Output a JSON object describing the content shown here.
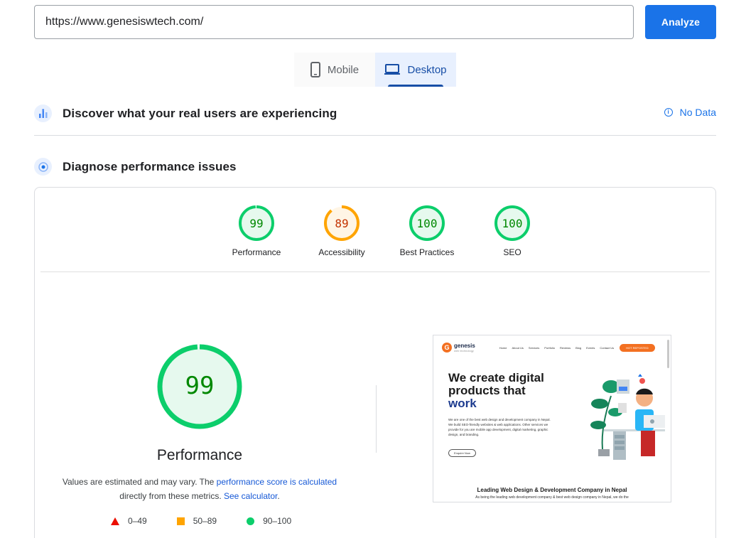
{
  "search": {
    "url": "https://www.genesiswtech.com/",
    "analyze_label": "Analyze"
  },
  "device_tabs": [
    {
      "label": "Mobile",
      "icon": "phone-icon",
      "active": false
    },
    {
      "label": "Desktop",
      "icon": "laptop-icon",
      "active": true
    }
  ],
  "field_section": {
    "title": "Discover what your real users are experiencing",
    "icon": "users-chart-icon",
    "status_icon": "info-icon",
    "status": "No Data"
  },
  "lab_section": {
    "title": "Diagnose performance issues",
    "icon": "target-icon"
  },
  "scores": [
    {
      "label": "Performance",
      "value": 99,
      "rating": "pass"
    },
    {
      "label": "Accessibility",
      "value": 89,
      "rating": "average"
    },
    {
      "label": "Best Practices",
      "value": 100,
      "rating": "pass"
    },
    {
      "label": "SEO",
      "value": 100,
      "rating": "pass"
    }
  ],
  "colors": {
    "pass": "#0cce6b",
    "pass_text": "#008800",
    "pass_fill": "#e6f9ee",
    "average": "#ffa400",
    "average_text": "#c33300",
    "average_fill": "#fff5e5",
    "fail": "#eb0f00",
    "accent": "#1a73e8"
  },
  "detail": {
    "value": 99,
    "label": "Performance",
    "note_prefix": "Values are estimated and may vary. The ",
    "note_link1": "performance score is calculated",
    "note_middle": " directly from these metrics. ",
    "note_link2": "See calculator",
    "note_suffix": "."
  },
  "legend": [
    {
      "range": "0–49",
      "shape": "triangle"
    },
    {
      "range": "50–89",
      "shape": "square"
    },
    {
      "range": "90–100",
      "shape": "circle"
    }
  ],
  "screenshot": {
    "logo_letter": "G",
    "logo_name": "genesis",
    "logo_sub": "web technology",
    "nav_links": [
      "Home",
      "About Us",
      "Services",
      "Portfolio",
      "Reviews",
      "Blog",
      "Events",
      "Contact Us"
    ],
    "cta": "HOT REPOSTED",
    "headline_1": "We create digital",
    "headline_2": "products that",
    "headline_3": "work",
    "paragraph": "We are one of the best web design and development company in Nepal. We build SEO-friendly websites & web applications. Other services we provide for you are mobile app development, digital marketing, graphic design, and branding.",
    "button": "Enquire Now",
    "footer_heading": "Leading Web Design & Development Company in Nepal",
    "footer_text": "As being the leading web development company & best web design company in Nepal, we do the"
  }
}
